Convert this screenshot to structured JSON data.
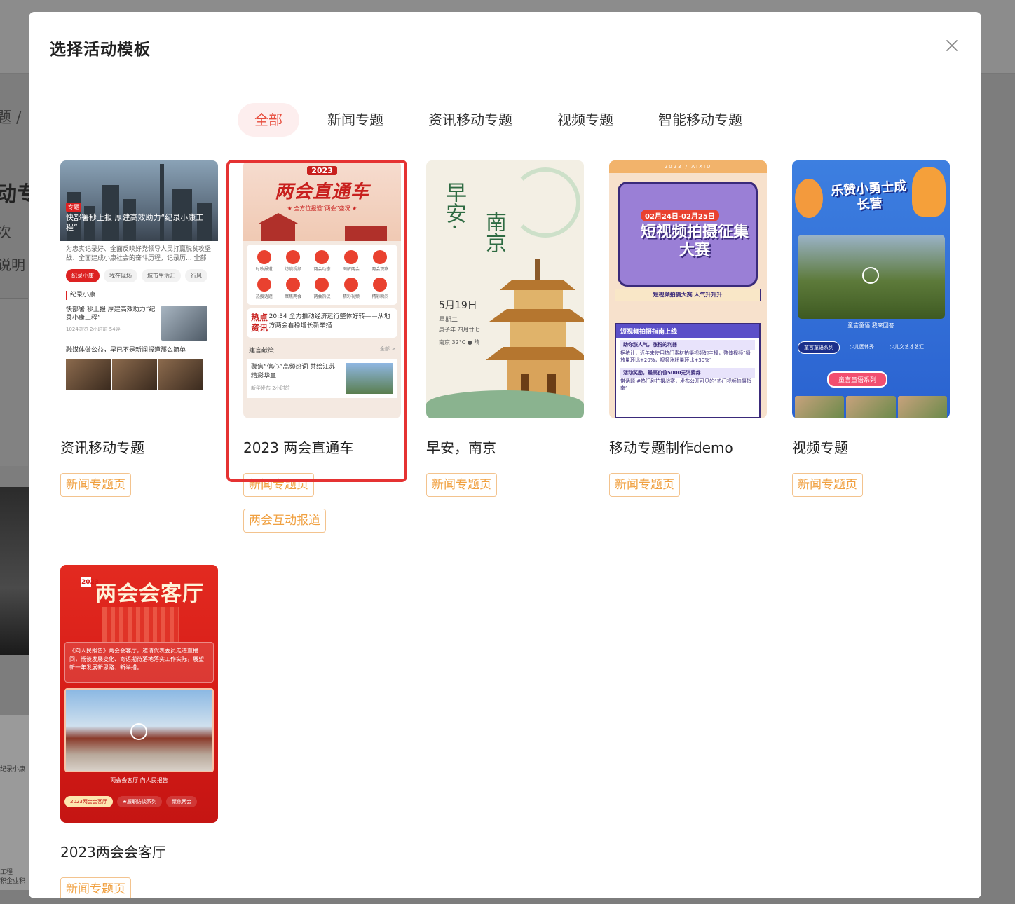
{
  "background": {
    "crumb": "题  /",
    "title": "动专",
    "line1": "次",
    "line2": "说明",
    "side_texts": [
      "纪录小康",
      "工程",
      "积企业积"
    ]
  },
  "modal": {
    "title": "选择活动模板",
    "close_icon": "close-icon"
  },
  "tabs": [
    {
      "label": "全部",
      "active": true
    },
    {
      "label": "新闻专题",
      "active": false
    },
    {
      "label": "资讯移动专题",
      "active": false
    },
    {
      "label": "视频专题",
      "active": false
    },
    {
      "label": "智能移动专题",
      "active": false
    }
  ],
  "templates": [
    {
      "name": "资讯移动专题",
      "tags": [
        "新闻专题页"
      ],
      "thumb": {
        "badge": "专题",
        "caption": "快部署秒上报 厚建高效助力“纪录小康工程”",
        "summary": "为忠实记录好、全面反映好党领导人民打赢脱贫攻坚战、全面建成小康社会的奋斗历程，记录历... 全部",
        "pills": [
          "纪录小康",
          "我在现场",
          "城市生活汇",
          "行风"
        ],
        "section": "纪录小康",
        "news": "快部署 秒上报 厚建高效助力“纪录小康工程”",
        "news_meta": "1024浏览  2小时前  54评",
        "news2": "融媒体做公益，早已不是新闻报道那么简单"
      }
    },
    {
      "name": "2023 两会直通车",
      "tags": [
        "新闻专题页",
        "两会互动报道"
      ],
      "selected": true,
      "thumb": {
        "year": "2023",
        "title": "两会直通车",
        "sub": "★ 全方位报道“两会”盛况 ★",
        "icons": [
          "时政报道",
          "访谈视频",
          "两会动态",
          "图解两会",
          "两会观察",
          "热搜话题",
          "聚焦两会",
          "两会热议",
          "精彩视频",
          "精彩瞬间"
        ],
        "hot_label": "热点资讯",
        "hot_text": "20:34 全力推动经济运行整体好转——从地方两会看稳增长新举措",
        "section": "建言献策",
        "section_more": "全部 >",
        "news": "聚焦“信心”高频热词 共绘江苏精彩华章",
        "news_meta": "新华发布  2小时前"
      }
    },
    {
      "name": "早安，南京",
      "tags": [
        "新闻专题页"
      ],
      "thumb": {
        "heading1": "早安·",
        "heading2": "南京",
        "date": "5月19日",
        "weekday": "星期二",
        "lunar": "庚子年 四月廿七",
        "weather": "南京 32°C ● 晴"
      }
    },
    {
      "name": "移动专题制作demo",
      "tags": [
        "新闻专题页"
      ],
      "thumb": {
        "strip": "2023 / AIXIU",
        "date": "02月24日-02月25日",
        "title": "短视频拍摄征集大赛",
        "bar": "短视频拍摄大赛  人气升升升",
        "panel_head": "短视频拍摄指南上线",
        "row1": "助你涨人气，涨粉的利器",
        "row1_text": "据统计，近年来使用热门素材拍摄视频的主播，整体视频“播放量环比+20%，视频涨粉量环比+30%”",
        "row2": "活动奖励，最高价值5000元消费券",
        "row2_text": "带话题 #热门剧拍摄战赛，发布公开可见的“热门视频拍摄指南”"
      }
    },
    {
      "name": "视频专题",
      "tags": [
        "新闻专题页"
      ],
      "thumb": {
        "title": "乐赞小勇士成长营",
        "caption": "童言童语 我来回答",
        "pills": [
          "童言童语系列",
          "少儿团体秀",
          "少儿文艺才艺汇"
        ],
        "button": "童言童语系列"
      }
    },
    {
      "name": "2023两会会客厅",
      "tags": [
        "新闻专题页"
      ],
      "thumb": {
        "year": "2023",
        "title": "两会会客厅",
        "text": "《向人民报告》两会会客厅，邀请代表委员走进直播间，畅谈发展变化、寄语期待落地落实工作实际，展望新一年发展新思路、新举措。",
        "caption": "两会会客厅 向人民报告",
        "pills": [
          "2023两会会客厅",
          "★履职访谈系列",
          "聚焦两会"
        ]
      }
    }
  ],
  "colors": {
    "accent": "#e74c3c",
    "tab_active_bg": "#fdeeee",
    "tag_border": "#f3c38e",
    "tag_text": "#f0a040",
    "highlight": "#e53232"
  }
}
